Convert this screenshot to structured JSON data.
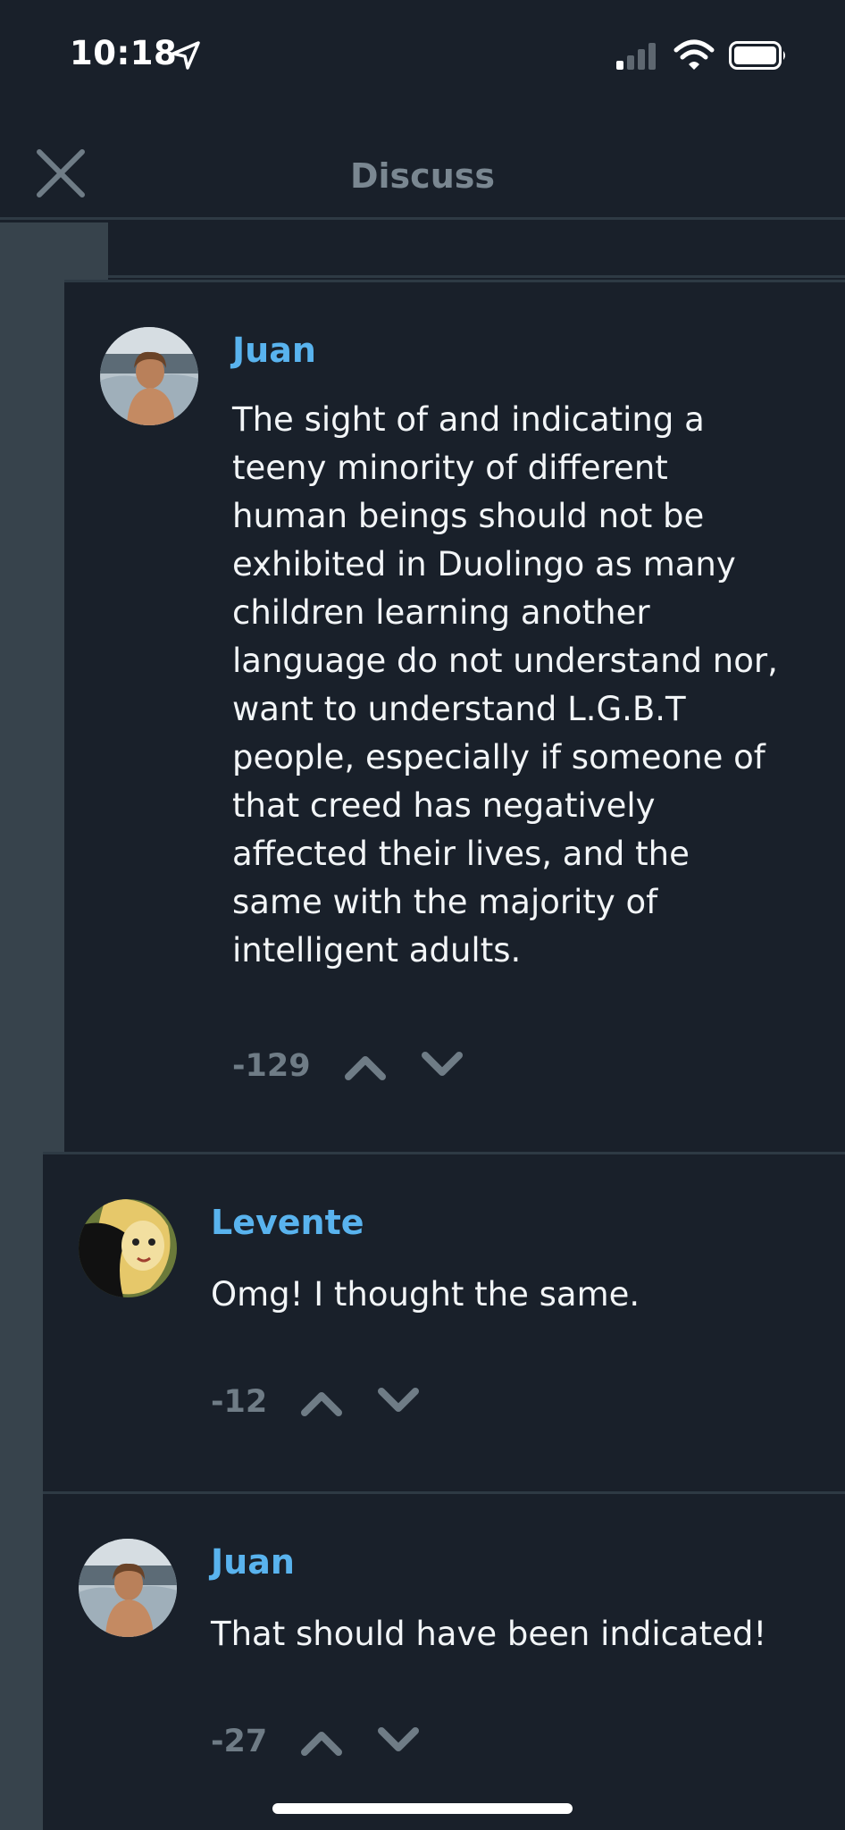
{
  "status_bar": {
    "time": "10:18",
    "icons": [
      "location-arrow-icon",
      "cellular-signal-icon",
      "wifi-icon",
      "battery-icon"
    ]
  },
  "header": {
    "title": "Discuss",
    "close_icon": "close-icon"
  },
  "colors": {
    "background": "#19202A",
    "rail": "#37434C",
    "divider": "#2E3A44",
    "username": "#59B3EE",
    "body_text": "#F2F5F7",
    "muted": "#6F7C86"
  },
  "comments": [
    {
      "author": "Juan",
      "text": "The sight of and indicating a\nteeny minority of different\nhuman beings should not be\nexhibited in Duolingo as many\nchildren learning another\nlanguage do not understand nor,\nwant to understand L.G.B.T\npeople, especially if someone of\nthat creed has negatively\naffected their lives, and the\nsame with the majority of\nintelligent adults.",
      "score": "-129"
    },
    {
      "author": "Levente",
      "text": "Omg! I thought the same.",
      "score": "-12"
    },
    {
      "author": "Juan",
      "text": "That should have been indicated!",
      "score": "-27"
    }
  ]
}
